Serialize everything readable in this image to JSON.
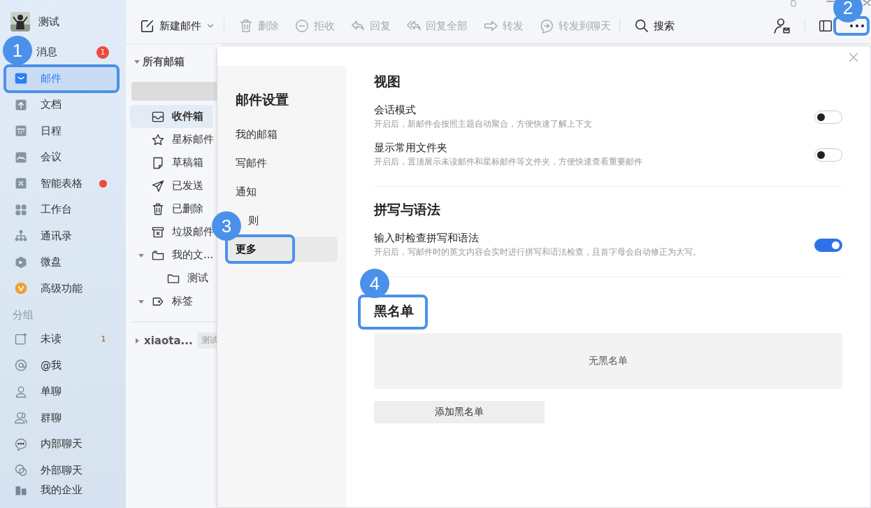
{
  "profile": {
    "name": "测试"
  },
  "sidebar": {
    "items": [
      {
        "label": "消息",
        "selected": false,
        "badge": "1",
        "callout": "1"
      },
      {
        "label": "邮件",
        "selected": true,
        "highlighted": true
      },
      {
        "label": "文档",
        "selected": false
      },
      {
        "label": "日程",
        "selected": false
      },
      {
        "label": "会议",
        "selected": false
      },
      {
        "label": "智能表格",
        "selected": false,
        "dot": true
      },
      {
        "label": "工作台",
        "selected": false
      },
      {
        "label": "通讯录",
        "selected": false
      },
      {
        "label": "微盘",
        "selected": false
      },
      {
        "label": "高级功能",
        "selected": false
      }
    ],
    "group_title": "分组",
    "groups": [
      {
        "label": "未读",
        "count": "1"
      },
      {
        "label": "@我"
      },
      {
        "label": "单聊"
      },
      {
        "label": "群聊"
      },
      {
        "label": "内部聊天"
      },
      {
        "label": "外部聊天"
      }
    ],
    "footer": {
      "label": "我的企业"
    }
  },
  "toolbar": {
    "buttons": [
      {
        "label": "新建邮件",
        "disabled": false,
        "dropdown": true
      },
      {
        "label": "删除",
        "disabled": true
      },
      {
        "label": "拒收",
        "disabled": true
      },
      {
        "label": "回复",
        "disabled": true
      },
      {
        "label": "回复全部",
        "disabled": true
      },
      {
        "label": "转发",
        "disabled": true
      },
      {
        "label": "转发到聊天",
        "disabled": true
      },
      {
        "label": "搜索",
        "disabled": false
      }
    ],
    "more_callout": "2"
  },
  "folders": {
    "header": "所有邮箱",
    "items": [
      {
        "label": "收件箱",
        "selected": true
      },
      {
        "label": "星标邮件",
        "selected": false
      },
      {
        "label": "草稿箱",
        "selected": false
      },
      {
        "label": "已发送",
        "selected": false
      },
      {
        "label": "已删除",
        "selected": false
      },
      {
        "label": "垃圾邮件",
        "selected": false
      },
      {
        "label": "我的文...",
        "selected": false,
        "expanded": true,
        "children": [
          {
            "label": "测试",
            "selected": false
          }
        ]
      },
      {
        "label": "标签",
        "selected": false,
        "expanded": true
      }
    ],
    "account": {
      "name": "xiaota...",
      "tag": "测试",
      "expanded": false
    }
  },
  "settings": {
    "title": "邮件设置",
    "nav": [
      {
        "label": "我的邮箱",
        "selected": false
      },
      {
        "label": "写邮件",
        "selected": false
      },
      {
        "label": "通知",
        "selected": false
      },
      {
        "label": "则",
        "selected": false
      },
      {
        "label": "更多",
        "selected": true,
        "callout": "3"
      }
    ],
    "sections": [
      {
        "title": "视图",
        "rows": [
          {
            "label": "会话模式",
            "description": "开启后，新邮件会按照主题自动聚合，方便快速了解上下文",
            "on": false
          },
          {
            "label": "显示常用文件夹",
            "description": "开启后，置顶展示未读邮件和星标邮件等文件夹，方便快速查看重要邮件",
            "on": false
          }
        ]
      },
      {
        "title": "拼写与语法",
        "rows": [
          {
            "label": "输入时检查拼写和语法",
            "description": "开启后，写邮件时的英文内容会实时进行拼写和语法检查，且首字母会自动修正为大写。",
            "on": true
          }
        ]
      }
    ],
    "blacklist": {
      "title": "黑名单",
      "callout": "4",
      "empty": "无黑名单",
      "button": "添加黑名单"
    }
  }
}
